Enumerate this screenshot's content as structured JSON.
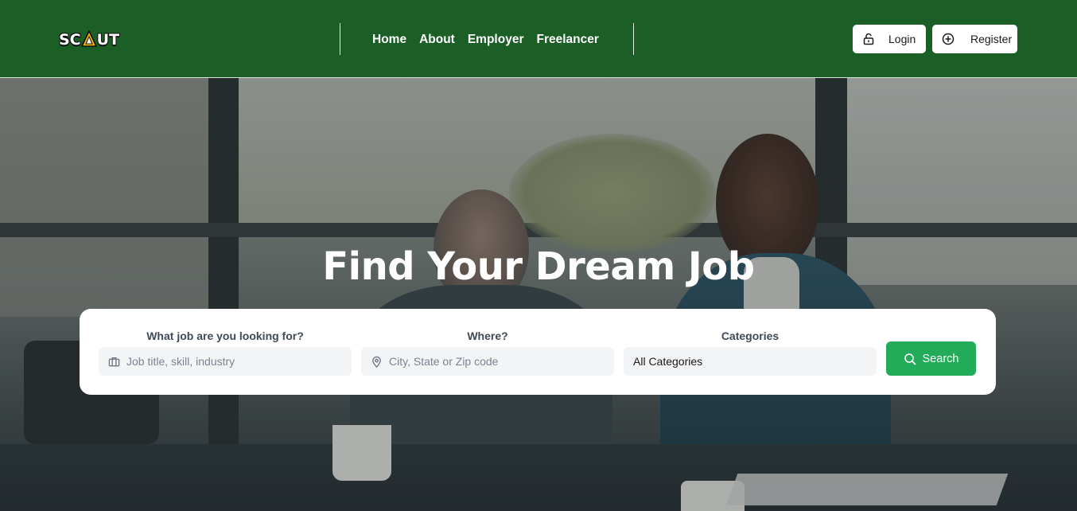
{
  "header": {
    "logo_text_left": "SC",
    "logo_text_right": "UT",
    "nav": [
      "Home",
      "About",
      "Employer",
      "Freelancer"
    ],
    "login_label": "Login",
    "register_label": "Register",
    "bg_color": "#1b5e26"
  },
  "hero": {
    "title": "Find Your Dream Job"
  },
  "search": {
    "job_label": "What job are you looking for?",
    "job_placeholder": "Job title, skill, industry",
    "where_label": "Where?",
    "where_placeholder": "City, State or Zip code",
    "category_label": "Categories",
    "category_value": "All Categories",
    "button_label": "Search",
    "button_color": "#22ac5a"
  },
  "icons": {
    "login": "lock-open-icon",
    "register": "plus-circle-icon",
    "job": "briefcase-icon",
    "where": "map-pin-icon",
    "search": "search-icon"
  }
}
